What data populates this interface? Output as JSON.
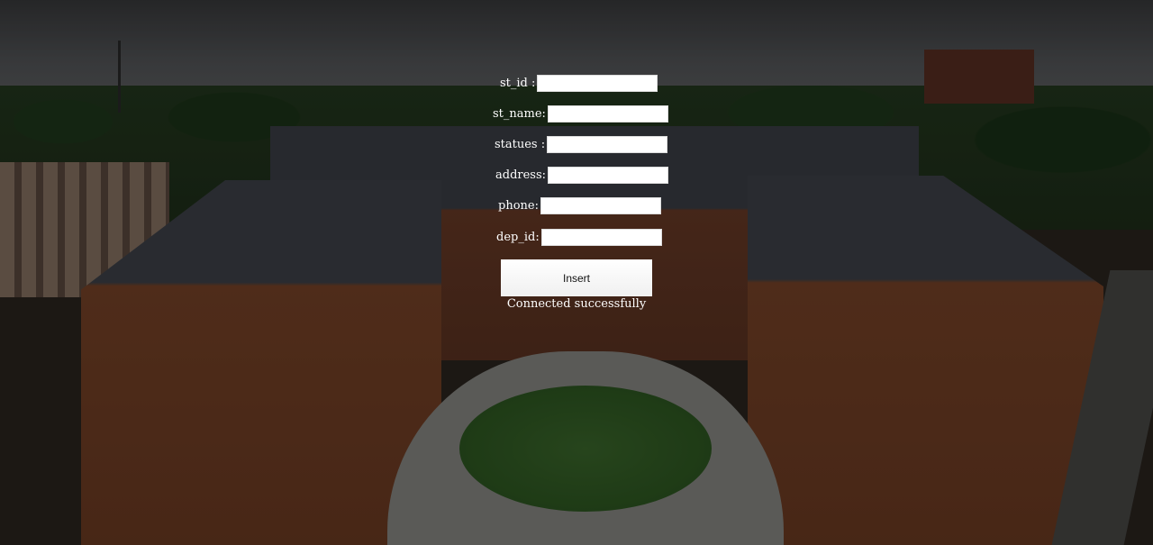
{
  "form": {
    "fields": [
      {
        "label": "st_id :",
        "value": ""
      },
      {
        "label": "st_name:",
        "value": ""
      },
      {
        "label": "statues :",
        "value": ""
      },
      {
        "label": "address:",
        "value": ""
      },
      {
        "label": "phone:",
        "value": ""
      },
      {
        "label": "dep_id:",
        "value": ""
      }
    ],
    "submit_label": "Insert",
    "status_message": "Connected successfully"
  }
}
